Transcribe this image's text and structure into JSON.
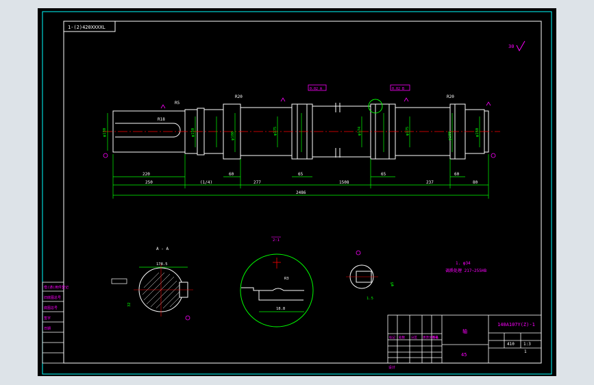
{
  "colors": {
    "background": "#dde3e8",
    "sheet": "#000000",
    "border": "#00ffff",
    "drawing": "#ffffff",
    "dimension": "#00ff00",
    "annotation": "#ff00ff",
    "centerline": "#ff0000"
  },
  "drawing_number_box": "1-(2)420XXXXL",
  "roughness_note": "30",
  "dimensions_bottom": {
    "total": "2486",
    "segments": [
      "250",
      "(1/4)",
      "277",
      "1508",
      "237",
      "80"
    ],
    "keyway_length": "220",
    "left_shoulder": "60",
    "right_shoulder": "60",
    "bearing_left": "65",
    "bearing_right": "65"
  },
  "diameters": [
    "φ130",
    "φ150",
    "φ180",
    "φ175",
    "φ174",
    "φ175",
    "φ180",
    "φ150"
  ],
  "radii": [
    "R20",
    "R20",
    "R18",
    "R5"
  ],
  "tolerance_frames": [
    "0.02 A",
    "0.02 B"
  ],
  "section_a_label": "A - A",
  "section_a_dims": [
    "178.5",
    "32"
  ],
  "detail_scale": "2:1",
  "detail_dims": [
    "18.8",
    "R3"
  ],
  "detail_b_dims": [
    "φ5",
    "1.5"
  ],
  "tech_notes": [
    "1. φ34",
    "调质处理 217~255HB"
  ],
  "title_block": {
    "drawing_code": "140A107Y(Z)-1",
    "part_name": "轴",
    "material": "45",
    "scale": "1:3",
    "weight": "410",
    "drawn_by": "设计",
    "sheet": "1"
  },
  "revision_header": [
    "标记",
    "处数",
    "分区",
    "更改文件号",
    "签名",
    "年月日"
  ]
}
